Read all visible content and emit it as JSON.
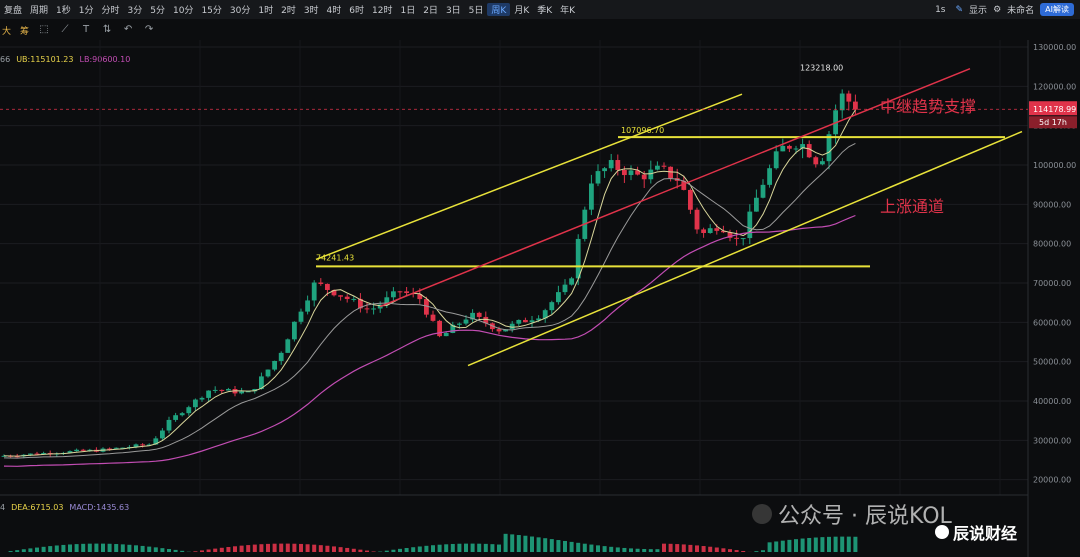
{
  "toolbar": {
    "replay": "复盘",
    "period": "周期",
    "intervals": [
      "1秒",
      "1分",
      "分时",
      "3分",
      "5分",
      "10分",
      "15分",
      "30分",
      "1时",
      "2时",
      "3时",
      "4时",
      "6时",
      "12时",
      "1日",
      "2日",
      "3日",
      "5日",
      "周K",
      "月K",
      "季K",
      "年K"
    ],
    "active_interval": "周K",
    "right_items": [
      "1s",
      "显示",
      "未命名",
      "AI解读"
    ]
  },
  "tools": {
    "a": "大",
    "b": "筹"
  },
  "indicators_top": {
    "prefix": "66",
    "ub": "UB:115101.23",
    "lb": "LB:90600.10"
  },
  "indicators_bottom": {
    "prefix": "4",
    "dea": "DEA:6715.03",
    "macd": "MACD:1435.63"
  },
  "price_labels": {
    "current": "114178.99",
    "countdown": "5d 17h"
  },
  "annotations": {
    "high": "123218.00",
    "mid_high": "107096.70",
    "low_level": "74241.43",
    "support_text": "中继趋势支撑",
    "channel_text": "上涨通道"
  },
  "watermark": {
    "account": "公众号 · 辰说KOL",
    "brand": "辰说财经"
  },
  "colors": {
    "up": "#1fa37f",
    "down": "#e0334a",
    "yellow": "#e8e23a",
    "red_line": "#e0334a",
    "ma_light": "#d8d59a",
    "ma_gray": "#9a9a9a",
    "ma_purple": "#c24db3"
  },
  "chart_data": {
    "type": "candlestick",
    "ylim": [
      20000,
      130000
    ],
    "yticks": [
      130000,
      120000,
      110000,
      100000,
      90000,
      80000,
      70000,
      60000,
      50000,
      40000,
      30000,
      20000
    ],
    "ytick_labels": [
      "130000.00",
      "120000.00",
      "110000.00",
      "100000.00",
      "90000.00",
      "80000.00",
      "70000.00",
      "60000.00",
      "50000.00",
      "40000.00",
      "30000.00",
      "20000.00"
    ],
    "annotated_levels": [
      123218.0,
      107096.7,
      74241.43
    ],
    "current_price": 114178.99
  }
}
